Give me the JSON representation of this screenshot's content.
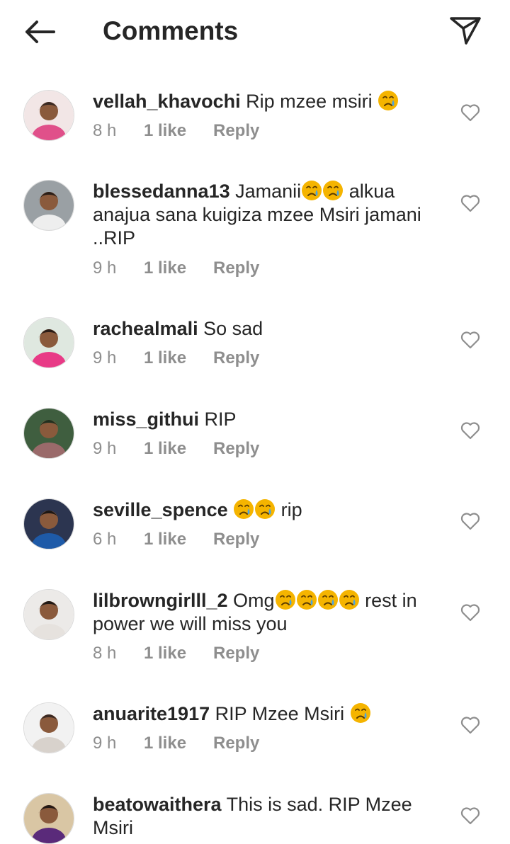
{
  "header": {
    "title": "Comments",
    "back_icon": "arrow-left-icon",
    "send_icon": "paper-plane-icon"
  },
  "colors": {
    "text": "#262626",
    "secondary": "#8e8e8e",
    "divider": "#dbdbdb",
    "emoji": "#f5b400"
  },
  "emoji": "crying-face-emoji",
  "comments": [
    {
      "username": "vellah_khavochi",
      "text": "Rip mzee msiri",
      "emoji_after": 1,
      "time": "8 h",
      "likes": "1 like",
      "reply": "Reply"
    },
    {
      "username": "blessedanna13",
      "text_before": "Jamanii",
      "emoji_mid": 2,
      "text": "alkua anajua sana kuigiza mzee Msiri jamani ..RIP",
      "time": "9 h",
      "likes": "1 like",
      "reply": "Reply"
    },
    {
      "username": "rachealmali",
      "text": "So sad",
      "time": "9 h",
      "likes": "1 like",
      "reply": "Reply"
    },
    {
      "username": "miss_githui",
      "text": "RIP",
      "time": "9 h",
      "likes": "1 like",
      "reply": "Reply"
    },
    {
      "username": "seville_spence",
      "emoji_mid": 2,
      "text": "rip",
      "time": "6 h",
      "likes": "1 like",
      "reply": "Reply"
    },
    {
      "username": "lilbrowngirlll_2",
      "text_before": "Omg",
      "emoji_mid": 4,
      "text": "rest in power we will miss you",
      "time": "8 h",
      "likes": "1 like",
      "reply": "Reply"
    },
    {
      "username": "anuarite1917",
      "text": "RIP Mzee Msiri",
      "emoji_after": 1,
      "time": "9 h",
      "likes": "1 like",
      "reply": "Reply"
    },
    {
      "username": "beatowaithera",
      "text": "This is sad. RIP Mzee Msiri"
    }
  ]
}
